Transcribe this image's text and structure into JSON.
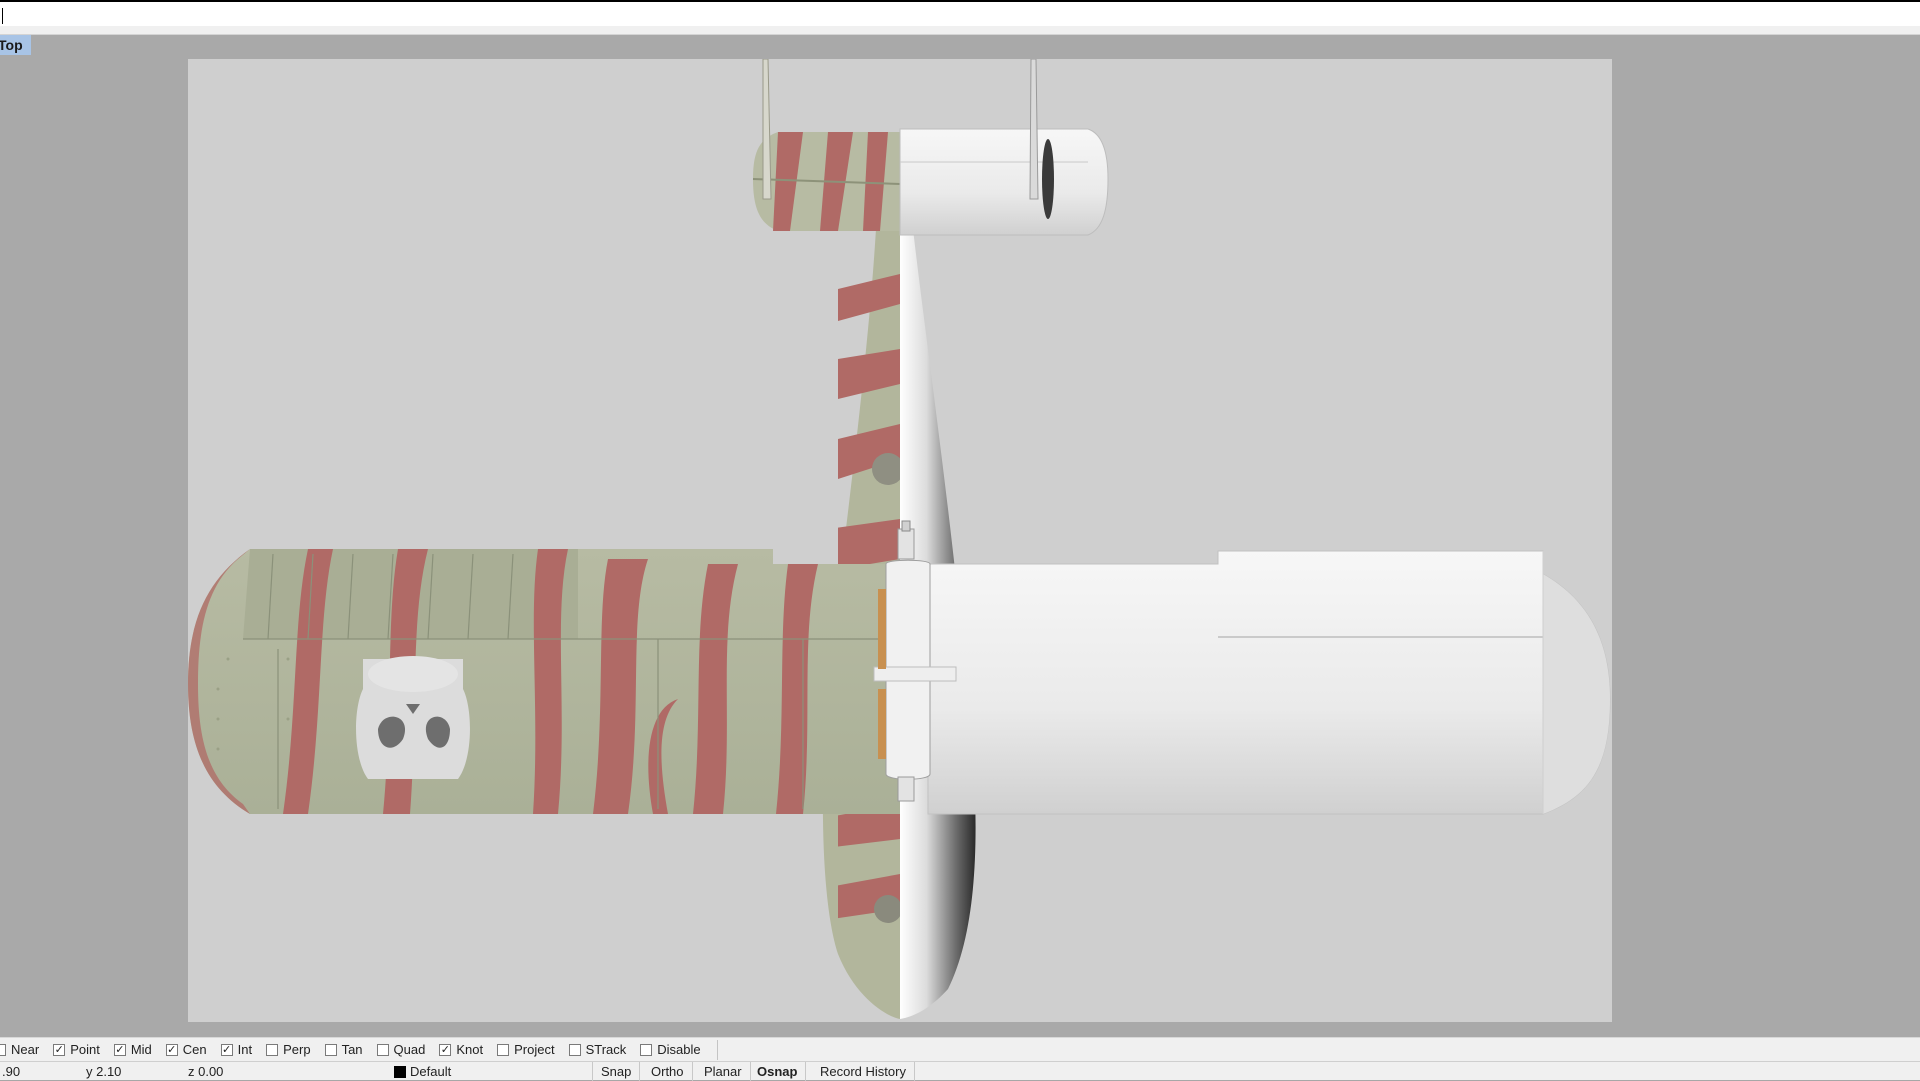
{
  "viewport": {
    "name": "Top"
  },
  "osnap": [
    {
      "label": "Near",
      "checked": false
    },
    {
      "label": "Point",
      "checked": true
    },
    {
      "label": "Mid",
      "checked": true
    },
    {
      "label": "Cen",
      "checked": true
    },
    {
      "label": "Int",
      "checked": true
    },
    {
      "label": "Perp",
      "checked": false
    },
    {
      "label": "Tan",
      "checked": false
    },
    {
      "label": "Quad",
      "checked": false
    },
    {
      "label": "Knot",
      "checked": true
    },
    {
      "label": "Project",
      "checked": false
    },
    {
      "label": "STrack",
      "checked": false
    },
    {
      "label": "Disable",
      "checked": false
    }
  ],
  "status": {
    "x": ".90",
    "y": "y 2.10",
    "z": "z 0.00",
    "layer": "Default",
    "panes": [
      "Snap",
      "Ortho",
      "Planar",
      "Osnap",
      "Record History"
    ]
  },
  "colors": {
    "camo_green": "#b3b89f",
    "camo_red": "#b06a66",
    "canvas": "#cfcfcf",
    "white_model": "#ececec"
  }
}
